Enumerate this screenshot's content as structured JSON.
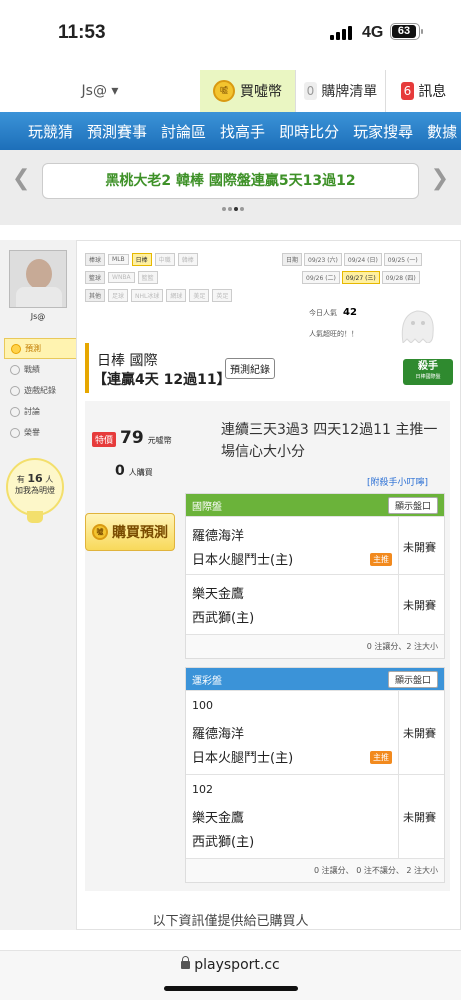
{
  "status": {
    "time": "11:53",
    "network": "4G",
    "battery": "63"
  },
  "topbar": {
    "user": "Js@ ▾",
    "buy_label": "買噓幣",
    "coin_text": "噓",
    "cart_count": "0",
    "cart_label": "購牌清單",
    "msg_count": "6",
    "msg_label": "訊息"
  },
  "nav": {
    "items": [
      "玩競猜",
      "預測賽事",
      "討論區",
      "找高手",
      "即時比分",
      "玩家搜尋",
      "數據"
    ]
  },
  "banner": {
    "text": "黑桃大老2 韓棒 國際盤連贏5天13過12"
  },
  "colors": {
    "accent_blue": "#1d6fb9",
    "green": "#3e9128",
    "orange": "#f28a1e",
    "red": "#e63b3b"
  },
  "sidebar": {
    "name": "Js@",
    "items": [
      {
        "label": "預測",
        "icon": "prediction-icon"
      },
      {
        "label": "戰績",
        "icon": "record-icon"
      },
      {
        "label": "遊戲紀錄",
        "icon": "history-icon"
      },
      {
        "label": "討論",
        "icon": "discussion-icon"
      },
      {
        "label": "榮譽",
        "icon": "honor-icon"
      }
    ],
    "bulb_prefix": "有",
    "bulb_count": "16",
    "bulb_suffix": "人",
    "bulb_line2": "加我為明燈"
  },
  "filters": {
    "rows": [
      {
        "label": "棒球",
        "tags": [
          "MLB",
          "日棒",
          "中職",
          "韓棒"
        ]
      },
      {
        "label": "籃球",
        "tags": [
          "WNBA",
          "籃籃"
        ]
      },
      {
        "label": "其他",
        "tags": [
          "足球",
          "NHL冰球",
          "網球",
          "美足",
          "英足"
        ]
      }
    ],
    "date_label": "日期",
    "dates_row1": [
      "09/23 (六)",
      "09/24 (日)",
      "09/25 (一)"
    ],
    "dates_row2": [
      "09/26 (二)",
      "09/27 (三)",
      "09/28 (四)"
    ]
  },
  "popularity": {
    "label": "今日人氣",
    "value": "42",
    "note": "人氣超旺的！！"
  },
  "match": {
    "title": "日棒 國際",
    "streak": "【連贏4天 12過11】",
    "record_btn": "預測紀錄",
    "killer_main": "殺手",
    "killer_sub": "日棒國際盤"
  },
  "card": {
    "price_tag": "特價",
    "price": "79",
    "price_unit": "元噓幣",
    "buyers": "0",
    "buyers_unit": "人購買",
    "desc": "連續三天3過3 四天12過11 主推一場信心大小分",
    "tip": "[附殺手小叮嚀]",
    "buy_btn": "購買預測"
  },
  "intl_market": {
    "title": "國際盤",
    "show_btn": "顯示盤口",
    "games": [
      {
        "num": "",
        "away": "羅德海洋",
        "home": "日本火腿鬥士(主)",
        "status": "未開賽",
        "badge": "主推"
      },
      {
        "num": "",
        "away": "樂天金鷹",
        "home": "西武獅(主)",
        "status": "未開賽",
        "badge": ""
      }
    ],
    "footer": "0 注讓分、2 注大小"
  },
  "lottery_market": {
    "title": "運彩盤",
    "show_btn": "顯示盤口",
    "games": [
      {
        "num": "100",
        "away": "羅德海洋",
        "home": "日本火腿鬥士(主)",
        "status": "未開賽",
        "badge": "主推"
      },
      {
        "num": "102",
        "away": "樂天金鷹",
        "home": "西武獅(主)",
        "status": "未開賽",
        "badge": ""
      }
    ],
    "footer": "0 注讓分、 0 注不讓分、 2 注大小"
  },
  "info": "以下資訊僅提供給已購買人",
  "browser": {
    "url": "playsport.cc"
  }
}
